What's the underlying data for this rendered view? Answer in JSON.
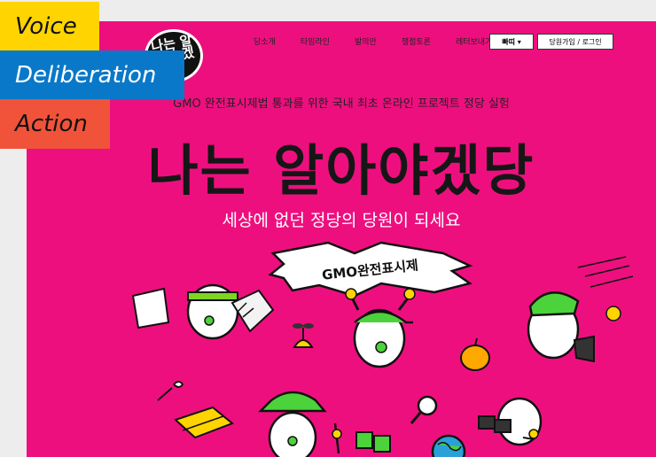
{
  "labels": {
    "voice": "Voice",
    "deliberation": "Deliberation",
    "action": "Action"
  },
  "logo": {
    "text": "나는 알아야 겠당"
  },
  "nav": {
    "items": [
      "당소개",
      "타임라인",
      "발의안",
      "쟁점토론",
      "레터보내기"
    ],
    "party_select": "빠띠 ▾",
    "auth": "당원가입 / 로그인"
  },
  "hero": {
    "tagline": "GMO 완전표시제법 통과를 위한 국내 최초 온라인 프로젝트 정당 실험",
    "headline": "나는 알아야겠당",
    "subhead": "세상에 없던 정당의 당원이 되세요",
    "banner": "GMO완전표시제"
  },
  "colors": {
    "background": "#ee0f7f",
    "voice": "#ffd400",
    "deliberation": "#0a78c8",
    "action": "#f0533a"
  }
}
